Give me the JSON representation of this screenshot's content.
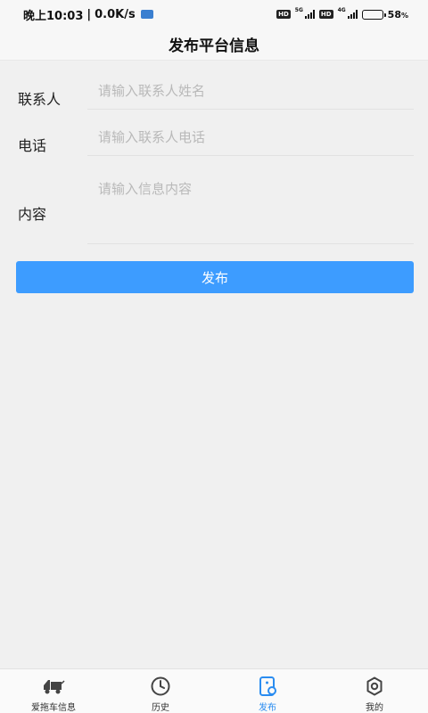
{
  "status_bar": {
    "time": "晚上10:03",
    "speed": "0.0K/s",
    "battery_percent": "58",
    "battery_unit": "%",
    "battery_level": 0.58,
    "hd_label": "HD",
    "net1": "5G",
    "net2": "4G"
  },
  "header": {
    "title": "发布平台信息"
  },
  "form": {
    "contact": {
      "label": "联系人",
      "placeholder": "请输入联系人姓名",
      "value": ""
    },
    "phone": {
      "label": "电话",
      "placeholder": "请输入联系人电话",
      "value": ""
    },
    "content": {
      "label": "内容",
      "placeholder": "请输入信息内容",
      "value": ""
    },
    "submit_label": "发布"
  },
  "bottom_nav": {
    "items": [
      {
        "label": "爱拖车信息",
        "icon": "tow-truck-icon",
        "active": false
      },
      {
        "label": "历史",
        "icon": "clock-icon",
        "active": false
      },
      {
        "label": "发布",
        "icon": "publish-icon",
        "active": true
      },
      {
        "label": "我的",
        "icon": "gear-icon",
        "active": false
      }
    ]
  },
  "colors": {
    "accent": "#2a8cf0",
    "button": "#3d9cff",
    "background": "#f0f0f0"
  }
}
